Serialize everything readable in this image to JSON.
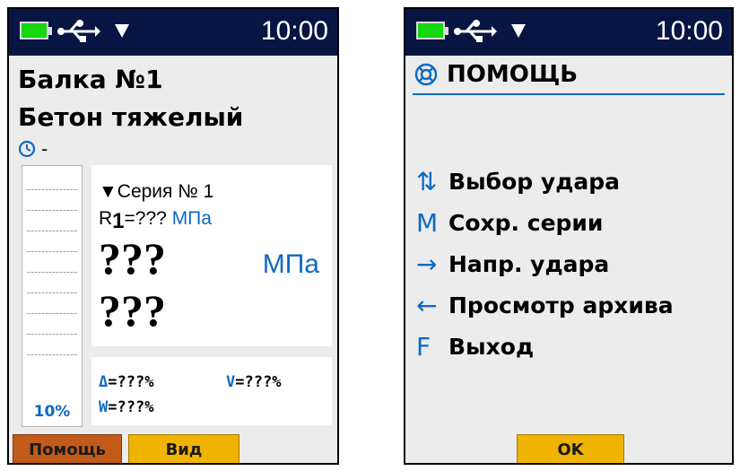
{
  "status_bar": {
    "time": "10:00",
    "icons": [
      "battery-icon",
      "usb-icon",
      "wifi-signal-icon"
    ]
  },
  "left_screen": {
    "title": "Балка №1",
    "subtitle": "Бетон тяжелый",
    "time_value": "-",
    "gauge_label": "10%",
    "series_label": "▼Серия № 1",
    "r1_prefix": "R",
    "r1_sub": "1",
    "r1_value": "=???",
    "r1_unit": "МПа",
    "big_value_1": "???",
    "big_value_2": "???",
    "big_unit": "МПа",
    "stats": {
      "delta_key": "Δ",
      "delta_val": "=???%",
      "v_key": "V",
      "v_val": "=???%",
      "w_key": "W",
      "w_val": "=???%"
    },
    "buttons": {
      "help": "Помощь",
      "view": "Вид"
    }
  },
  "right_screen": {
    "heading": "ПОМОЩЬ",
    "items": [
      {
        "symbol": "⇅",
        "text": "Выбор удара"
      },
      {
        "symbol": "M",
        "text": "Сохр. серии"
      },
      {
        "symbol": "→",
        "text": "Напр. удара"
      },
      {
        "symbol": "←",
        "text": "Просмотр архива"
      },
      {
        "symbol": "F",
        "text": "Выход"
      }
    ],
    "ok_button": "OK"
  },
  "colors": {
    "status_bg": "#071542",
    "accent_blue": "#0c69c4",
    "button_orange": "#c25a1a",
    "button_yellow": "#f0b400",
    "battery_green": "#15d60f"
  }
}
